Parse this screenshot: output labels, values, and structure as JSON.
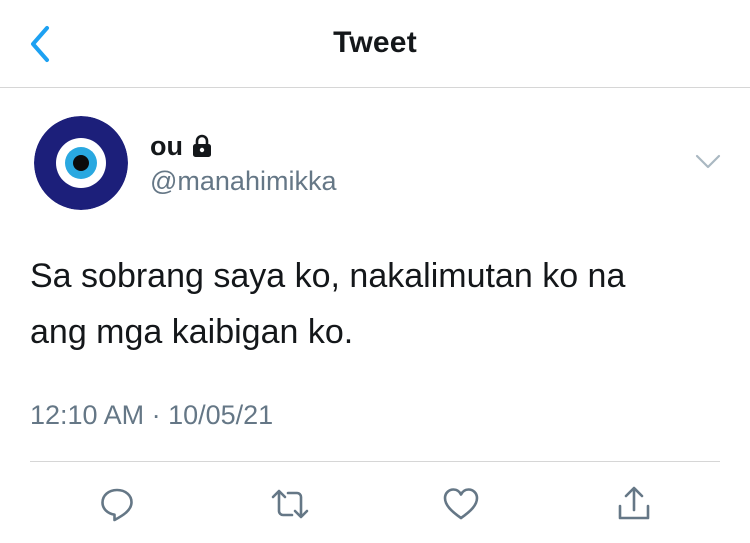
{
  "header": {
    "title": "Tweet",
    "back_icon": "chevron-left-icon"
  },
  "tweet": {
    "author": {
      "display_name": "ou",
      "handle": "@manahimikka",
      "protected_icon": "lock-icon",
      "avatar_icon": "evil-eye-icon"
    },
    "text_lines": [
      "Sa sobrang saya ko, nakalimutan ko na",
      "ang mga kaibigan ko."
    ],
    "timestamp": "12:10 AM · 10/05/21",
    "more_icon": "chevron-down-icon"
  },
  "actions": [
    {
      "name": "reply",
      "icon": "reply-icon"
    },
    {
      "name": "retweet",
      "icon": "retweet-icon"
    },
    {
      "name": "like",
      "icon": "heart-icon"
    },
    {
      "name": "share",
      "icon": "share-icon"
    }
  ],
  "colors": {
    "accent": "#1da1f2",
    "secondary_text": "#657786",
    "primary_text": "#14171a",
    "divider": "#d6d6d6",
    "icon_gray": "#657786",
    "avatar_navy": "#1c1f7a",
    "avatar_blue": "#29a8e0"
  }
}
